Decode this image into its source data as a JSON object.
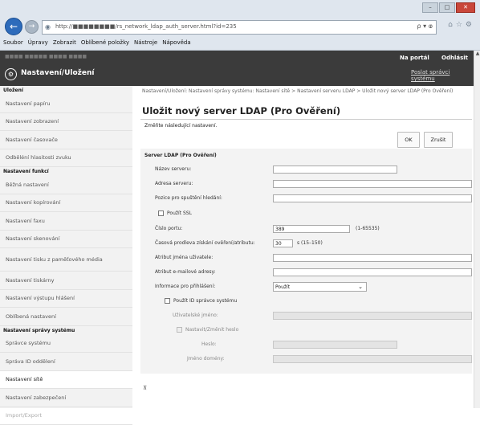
{
  "browser": {
    "url": "http://■■■■■■■■/rs_network_ldap_auth_server.html?id=235",
    "addr_tools": "ρ ▾ ⱷ",
    "menu": [
      "Soubor",
      "Úpravy",
      "Zobrazit",
      "Oblíbené položky",
      "Nástroje",
      "Nápověda"
    ],
    "icons": {
      "back": "back-arrow-icon",
      "forward": "forward-arrow-icon",
      "home": "home-icon",
      "star": "favorites-star-icon",
      "settings": "settings-gear-icon"
    }
  },
  "header": {
    "title": "Nastavení/Uložení",
    "portal": "Na portál",
    "logout": "Odhlásit",
    "send_link": "Poslat správci systému",
    "bg_color": "#3b3b3b"
  },
  "sidebar": {
    "groups": [
      {
        "heading": "Uložení",
        "items": [
          "Nastavení papíru",
          "Nastavení zobrazení",
          "Nastavení časovače",
          "Odběléní hlasitosti zvuku"
        ]
      },
      {
        "heading": "Nastavení funkcí",
        "items": [
          "Běžná nastavení",
          "Nastavení kopírování",
          "Nastavení faxu",
          "Nastavení skenování",
          "Nastavení tisku z paměťového média",
          "Nastavení tiskárny",
          "Nastavení výstupu hlášení",
          "Oblíbená nastavení"
        ]
      },
      {
        "heading": "Nastavení správy systému",
        "items": [
          "Správce systému",
          "Správa ID oddělení",
          "Nastavení sítě",
          "Nastavení zabezpečení",
          "Import/Export"
        ]
      }
    ]
  },
  "main": {
    "breadcrumb": "Nastavení/Uložení: Nastavení správy systému: Nastavení sítě > Nastavení serveru LDAP > Uložit nový server LDAP (Pro Ověření)",
    "title": "Uložit nový server LDAP (Pro Ověření)",
    "hint": "Změňte následující nastavení.",
    "ok_label": "OK",
    "cancel_label": "Zrušit",
    "section_title": "Server LDAP (Pro Ověření)",
    "form": {
      "server_name": {
        "label": "Název serveru:",
        "value": ""
      },
      "server_address": {
        "label": "Adresa serveru:",
        "value": ""
      },
      "search_root": {
        "label": "Pozice pro spuštění hledání:",
        "value": ""
      },
      "use_ssl": {
        "label": "Použít SSL",
        "checked": false
      },
      "port": {
        "label": "Číslo portu:",
        "value": "389",
        "range": "(1-65535)"
      },
      "timeout": {
        "label": "Časová prodleva získání ověření/atributu:",
        "value": "30",
        "range": "s (15–150)"
      },
      "attr_username": {
        "label": "Atribut jména uživatele:",
        "value": ""
      },
      "attr_email": {
        "label": "Atribut e-mailové adresy:",
        "value": ""
      },
      "login_info": {
        "label": "Informace pro přihlášení:",
        "selected": "Použít"
      },
      "use_admin_id": {
        "label": "Použít ID správce systému",
        "checked": false
      },
      "username": {
        "label": "Uživatelské jméno:",
        "value": ""
      },
      "set_password": {
        "label": "Nastavit/Změnit heslo",
        "checked": false
      },
      "password": {
        "label": "Heslo:",
        "value": ""
      },
      "domain": {
        "label": "Jméno domény:",
        "value": ""
      }
    }
  }
}
